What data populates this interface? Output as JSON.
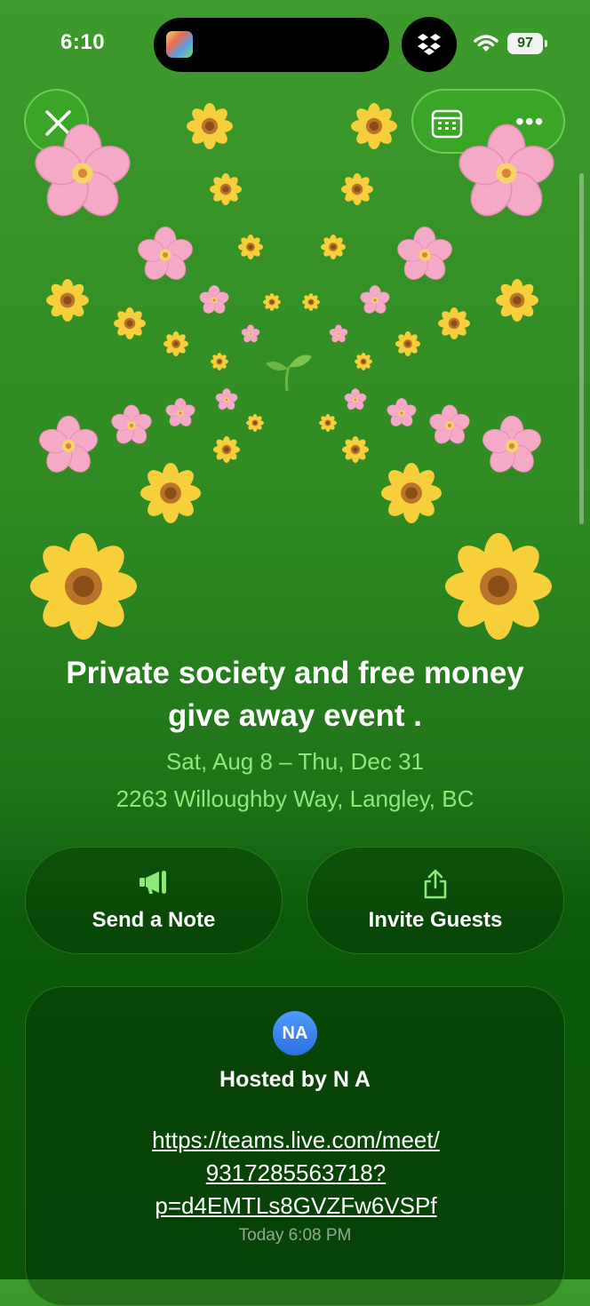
{
  "status_bar": {
    "time": "6:10",
    "battery": "97"
  },
  "event": {
    "title_line1": "Private society and free money",
    "title_line2": "give away event .",
    "date_range": "Sat, Aug 8 – Thu, Dec 31",
    "address": "2263 Willoughby Way, Langley, BC"
  },
  "actions": {
    "send_note": "Send a Note",
    "invite_guests": "Invite Guests"
  },
  "host": {
    "avatar_initials": "NA",
    "hosted_by": "Hosted by N A",
    "link_line1": "https://teams.live.com/meet/",
    "link_line2": "9317285563718?",
    "link_line3": "p=d4EMTLs8GVZFw6VSPf",
    "timestamp": "Today 6:08 PM"
  },
  "colors": {
    "background_top": "#3d9a2c",
    "background_bottom": "#0b540a",
    "accent_text": "#8ee87a",
    "avatar": "#2b6fe0"
  },
  "icons": [
    "close-icon",
    "calendar-icon",
    "more-icon",
    "megaphone-icon",
    "share-icon",
    "wifi-icon",
    "battery-icon"
  ]
}
